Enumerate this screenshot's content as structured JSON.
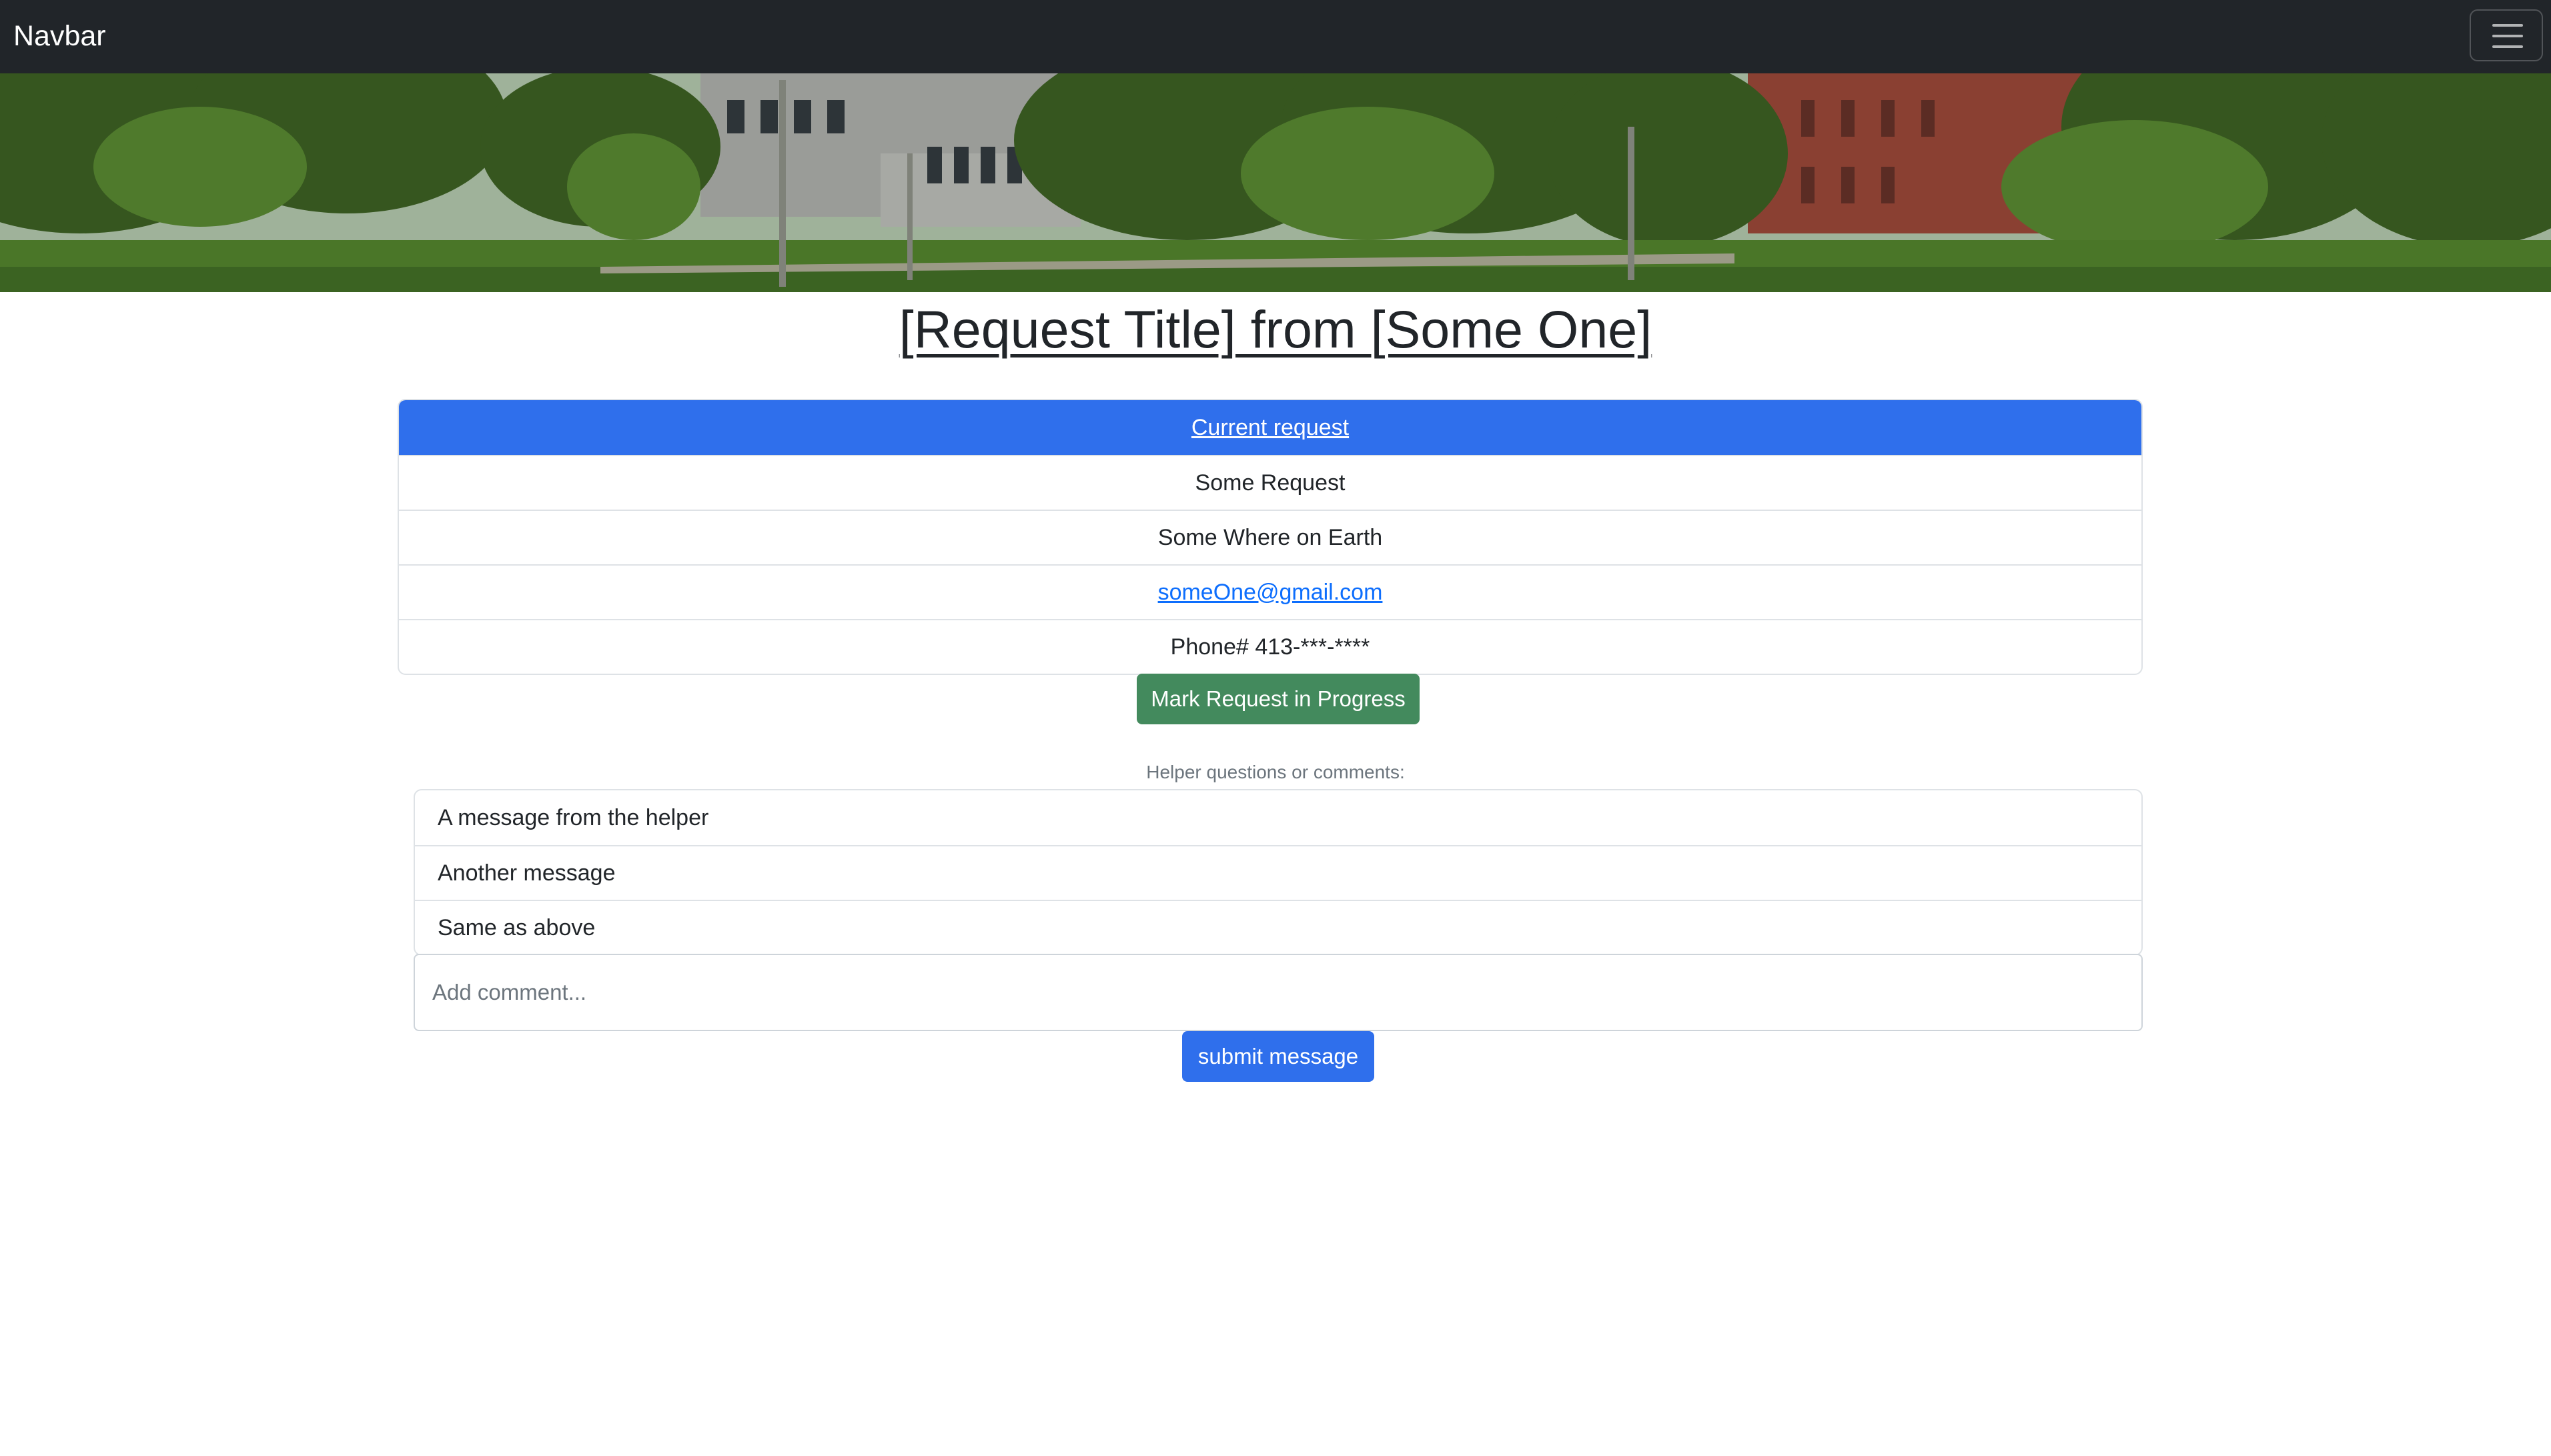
{
  "navbar": {
    "brand": "Navbar",
    "toggler_icon": "hamburger-menu-icon"
  },
  "banner": {
    "description_icon": "campus-photo"
  },
  "page": {
    "title": "[Request Title] from [Some One]"
  },
  "request": {
    "header": "Current request",
    "name": "Some Request",
    "location": "Some Where on Earth",
    "email": "someOne@gmail.com",
    "phone": "Phone# 413-***-****"
  },
  "actions": {
    "mark_in_progress": "Mark Request in Progress",
    "submit_message": "submit message"
  },
  "comments": {
    "label": "Helper questions or comments:",
    "items": [
      "A message from the helper",
      "Another message",
      "Same as above"
    ],
    "input_placeholder": "Add comment..."
  },
  "colors": {
    "navbar_bg": "#212529",
    "primary": "#2f6fec",
    "success": "#438a5d",
    "link": "#0d6efd"
  }
}
